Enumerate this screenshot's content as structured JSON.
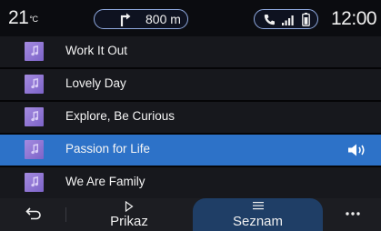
{
  "status": {
    "temperature": "21",
    "temperature_unit": "°C",
    "nav_distance": "800 m",
    "nav_icon": "turn-right-arrow-icon",
    "phone_icons": [
      "phone-icon",
      "signal-icon",
      "battery-icon"
    ],
    "clock": "12:00"
  },
  "tracks": [
    {
      "title": "Work It Out",
      "active": false
    },
    {
      "title": "Lovely Day",
      "active": false
    },
    {
      "title": "Explore, Be Curious",
      "active": false
    },
    {
      "title": "Passion for Life",
      "active": true
    },
    {
      "title": "We Are Family",
      "active": false
    }
  ],
  "now_playing_icon": "speaker-volume-icon",
  "bottom_bar": {
    "back_icon": "back-arrow-icon",
    "prikaz_label": "Prikaz",
    "prikaz_icon": "play-outline-icon",
    "seznam_label": "Seznam",
    "seznam_icon": "list-lines-icon",
    "more_icon": "more-dots-icon"
  },
  "colors": {
    "active_row": "#2d72c8",
    "row_bg": "#17181d",
    "pill_border": "#8fa9e0",
    "seznam_tab": "#1f3e66",
    "album_art": "#9278d8"
  }
}
